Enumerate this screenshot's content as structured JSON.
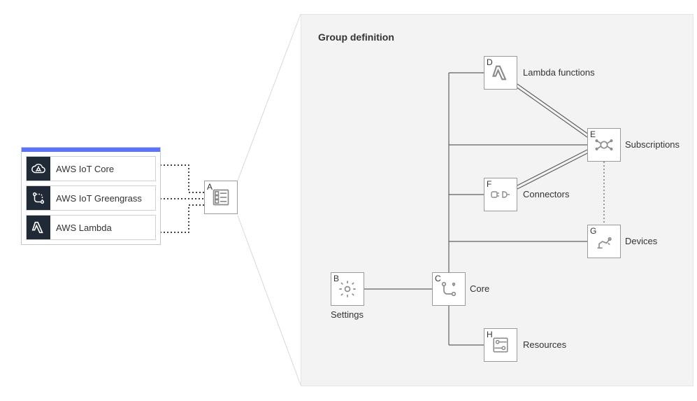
{
  "services": {
    "items": [
      {
        "label": "AWS IoT Core",
        "icon": "aws-iot-core-icon"
      },
      {
        "label": "AWS IoT Greengrass",
        "icon": "aws-iot-greengrass-icon"
      },
      {
        "label": "AWS Lambda",
        "icon": "aws-lambda-icon"
      }
    ]
  },
  "center_node": {
    "letter": "A",
    "label": "",
    "icon": "group-icon"
  },
  "panel": {
    "title": "Group definition"
  },
  "nodes": {
    "B": {
      "letter": "B",
      "label": "Settings",
      "icon": "gear-icon"
    },
    "C": {
      "letter": "C",
      "label": "Core",
      "icon": "core-icon"
    },
    "D": {
      "letter": "D",
      "label": "Lambda functions",
      "icon": "lambda-icon"
    },
    "E": {
      "letter": "E",
      "label": "Subscriptions",
      "icon": "subscriptions-icon"
    },
    "F": {
      "letter": "F",
      "label": "Connectors",
      "icon": "connectors-icon"
    },
    "G": {
      "letter": "G",
      "label": "Devices",
      "icon": "devices-icon"
    },
    "H": {
      "letter": "H",
      "label": "Resources",
      "icon": "resources-icon"
    }
  },
  "colors": {
    "accent": "#5b74ff",
    "dark": "#1f2a36",
    "line": "#606060"
  }
}
